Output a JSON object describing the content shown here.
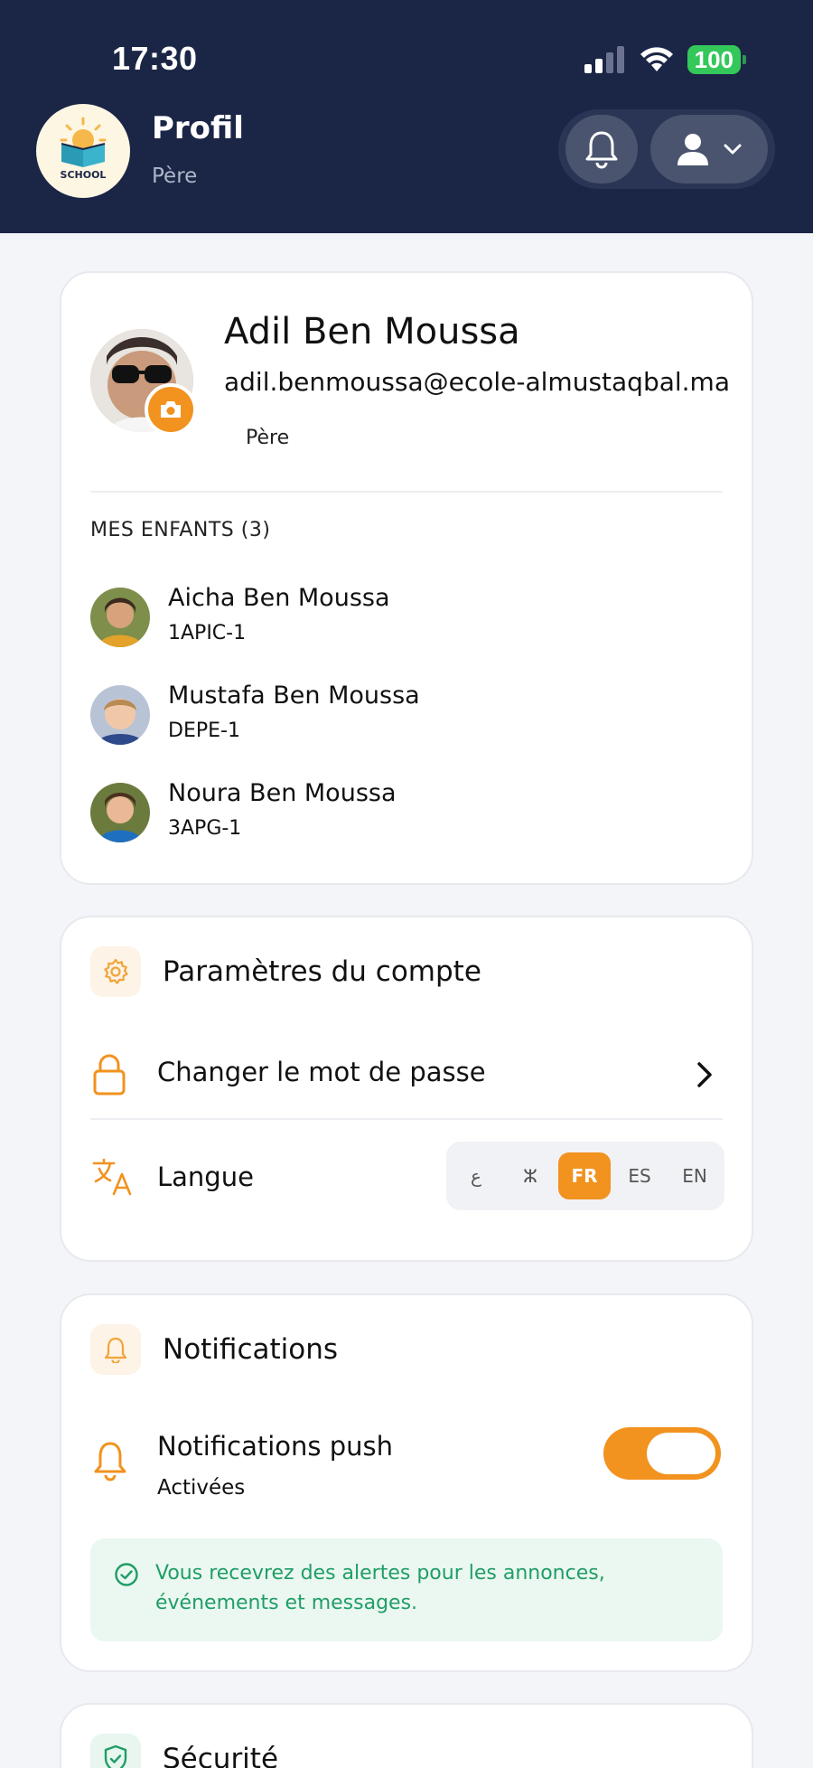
{
  "status_bar": {
    "time": "17:30",
    "battery": "100"
  },
  "header": {
    "logo_text": "SCHOOL",
    "title": "Profil",
    "subtitle": "Père"
  },
  "profile": {
    "name": "Adil Ben Moussa",
    "email": "adil.benmoussa@ecole-almustaqbal.ma",
    "role": "Père",
    "children_title": "MES ENFANTS (3)",
    "children": [
      {
        "name": "Aicha Ben Moussa",
        "class": "1APIC-1"
      },
      {
        "name": "Mustafa Ben Moussa",
        "class": "DEPE-1"
      },
      {
        "name": "Noura Ben Moussa",
        "class": "3APG-1"
      }
    ]
  },
  "account_settings": {
    "title": "Paramètres du compte",
    "change_password": "Changer le mot de passe",
    "language_label": "Langue",
    "languages": [
      "ع",
      "ⵣ",
      "FR",
      "ES",
      "EN"
    ],
    "selected_language": "FR"
  },
  "notifications": {
    "title": "Notifications",
    "push_label": "Notifications push",
    "push_status": "Activées",
    "push_enabled": true,
    "info": "Vous recevrez des alertes pour les annonces, événements et messages."
  },
  "security": {
    "title": "Sécurité"
  },
  "colors": {
    "header_bg": "#1b2646",
    "accent": "#f2921f",
    "success": "#1f9e66",
    "page_bg": "#f4f5f9"
  }
}
